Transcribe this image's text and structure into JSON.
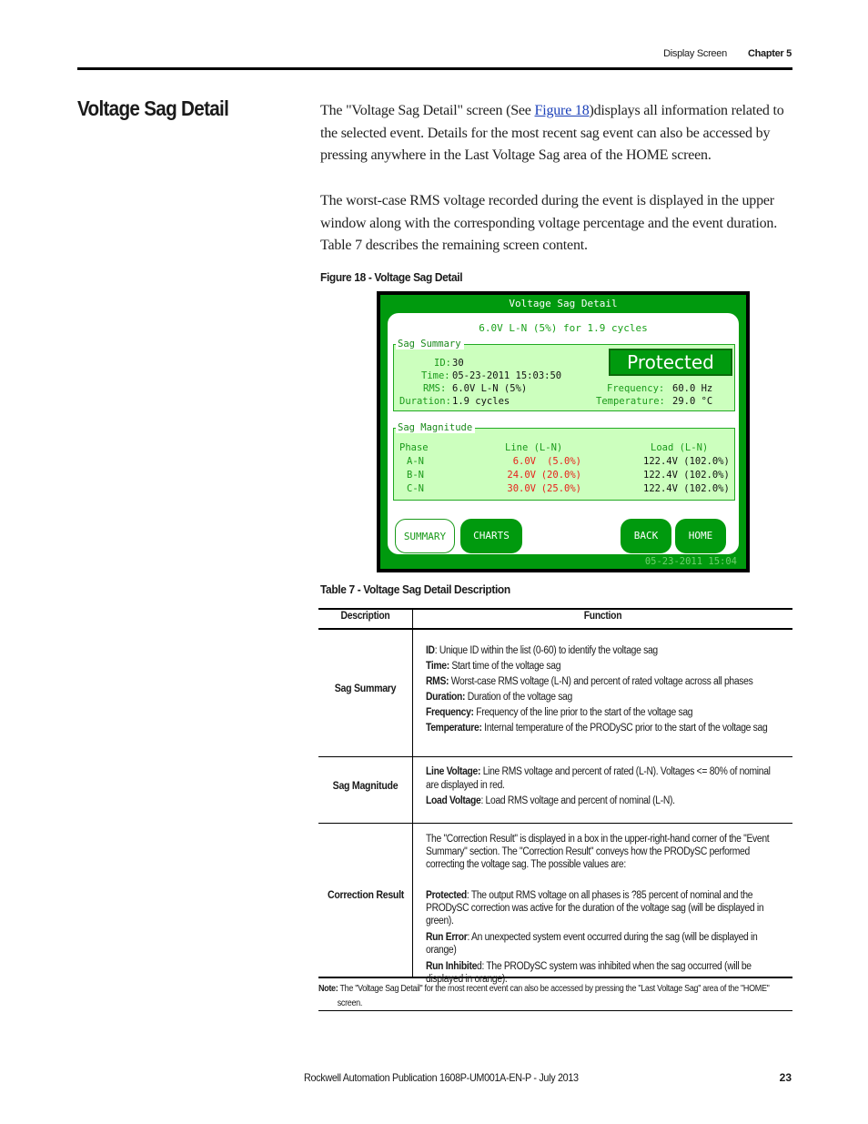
{
  "header": {
    "section": "Display Screen",
    "chapter": "Chapter 5"
  },
  "section_title": "Voltage Sag Detail",
  "paragraphs": {
    "p1_before": "The \"Voltage Sag Detail\" screen (See ",
    "p1_link": "Figure 18",
    "p1_after": ")displays all information related to the selected event. Details for the most recent sag event can also be accessed by pressing anywhere in the Last Voltage Sag area of the HOME screen.",
    "p2": "The worst-case RMS voltage recorded during the event is displayed in the upper window along with the corresponding voltage percentage and the event duration. Table 7 describes the remaining screen content."
  },
  "figure": {
    "caption": "Figure 18 - Voltage Sag Detail",
    "screen": {
      "title": "Voltage Sag Detail",
      "headline": "6.0V L-N (5%) for 1.9 cycles",
      "summary": {
        "legend": "Sag Summary",
        "id_label": "ID:",
        "id_value": "30",
        "time_label": "Time:",
        "time_value": "05-23-2011 15:03:50",
        "rms_label": "RMS:",
        "rms_value": "6.0V L-N (5%)",
        "duration_label": "Duration:",
        "duration_value": "1.9 cycles",
        "frequency_label": "Frequency:",
        "frequency_value": "60.0 Hz",
        "temperature_label": "Temperature:",
        "temperature_value": "29.0 °C",
        "result": "Protected",
        "result_color": "#009a0e"
      },
      "magnitude": {
        "legend": "Sag Magnitude",
        "headers": [
          "Phase",
          "Line (L-N)",
          "Load (L-N)"
        ],
        "rows": [
          {
            "phase": "A-N",
            "line_v": "6.0V",
            "line_pct": "(5.0%)",
            "load": "122.4V (102.0%)"
          },
          {
            "phase": "B-N",
            "line_v": "24.0V",
            "line_pct": "(20.0%)",
            "load": "122.4V (102.0%)"
          },
          {
            "phase": "C-N",
            "line_v": "30.0V",
            "line_pct": "(25.0%)",
            "load": "122.4V (102.0%)"
          }
        ]
      },
      "buttons": {
        "summary": "SUMMARY",
        "charts": "CHARTS",
        "back": "BACK",
        "home": "HOME"
      },
      "datetime": "05-23-2011 15:04"
    }
  },
  "table": {
    "caption": "Table 7 - Voltage Sag Detail Description",
    "headers": [
      "Description",
      "Function"
    ],
    "rows": [
      {
        "description": "Sag Summary",
        "lines": [
          {
            "bold": "ID",
            "text": ": Unique ID within the list (0-60) to identify the voltage sag"
          },
          {
            "bold": "Time:",
            "text": " Start time of the voltage sag"
          },
          {
            "bold": "RMS:",
            "text": " Worst-case RMS voltage (L-N) and percent of rated voltage across all phases"
          },
          {
            "bold": "Duration:",
            "text": " Duration of the voltage sag"
          },
          {
            "bold": "Frequency:",
            "text": " Frequency of the line prior to the start of the voltage sag"
          },
          {
            "bold": "Temperature:",
            "text": " Internal temperature of the PRODySC prior to the start of the voltage sag"
          }
        ]
      },
      {
        "description": "Sag Magnitude",
        "lines": [
          {
            "bold": "Line Voltage:",
            "text": " Line RMS voltage and percent of rated (L-N). Voltages <= 80% of nominal are displayed in red."
          },
          {
            "bold": "Load Voltage",
            "text": ": Load RMS voltage and percent of nominal (L-N)."
          }
        ]
      },
      {
        "description": "Correction Result",
        "intro": "The \"Correction Result\" is displayed in a box in the upper-right-hand corner of the \"Event Summary\" section. The \"Correction Result\" conveys how the PRODySC performed correcting the voltage sag. The possible values are:",
        "lines": [
          {
            "bold": "Protected",
            "text": ": The output RMS voltage on all phases is ?85 percent of nominal and the PRODySC correction was active for the duration of the voltage sag (will be displayed in green)."
          },
          {
            "bold": "Run Error",
            "text": ": An unexpected system event occurred during the sag (will be displayed in orange)"
          },
          {
            "bold": "Run Inhibite",
            "text": "d: The PRODySC system was inhibited when the sag occurred (will be displayed in orange)."
          }
        ]
      }
    ],
    "note_label": "Note:",
    "note_text": " The \"Voltage Sag Detail\" for the most recent event can also be accessed by pressing the \"Last Voltage Sag\" area of the \"HOME\"",
    "note_cont": "screen."
  },
  "footer": {
    "publication": "Rockwell Automation Publication 1608P-UM001A-EN-P - July 2013",
    "page": "23"
  }
}
